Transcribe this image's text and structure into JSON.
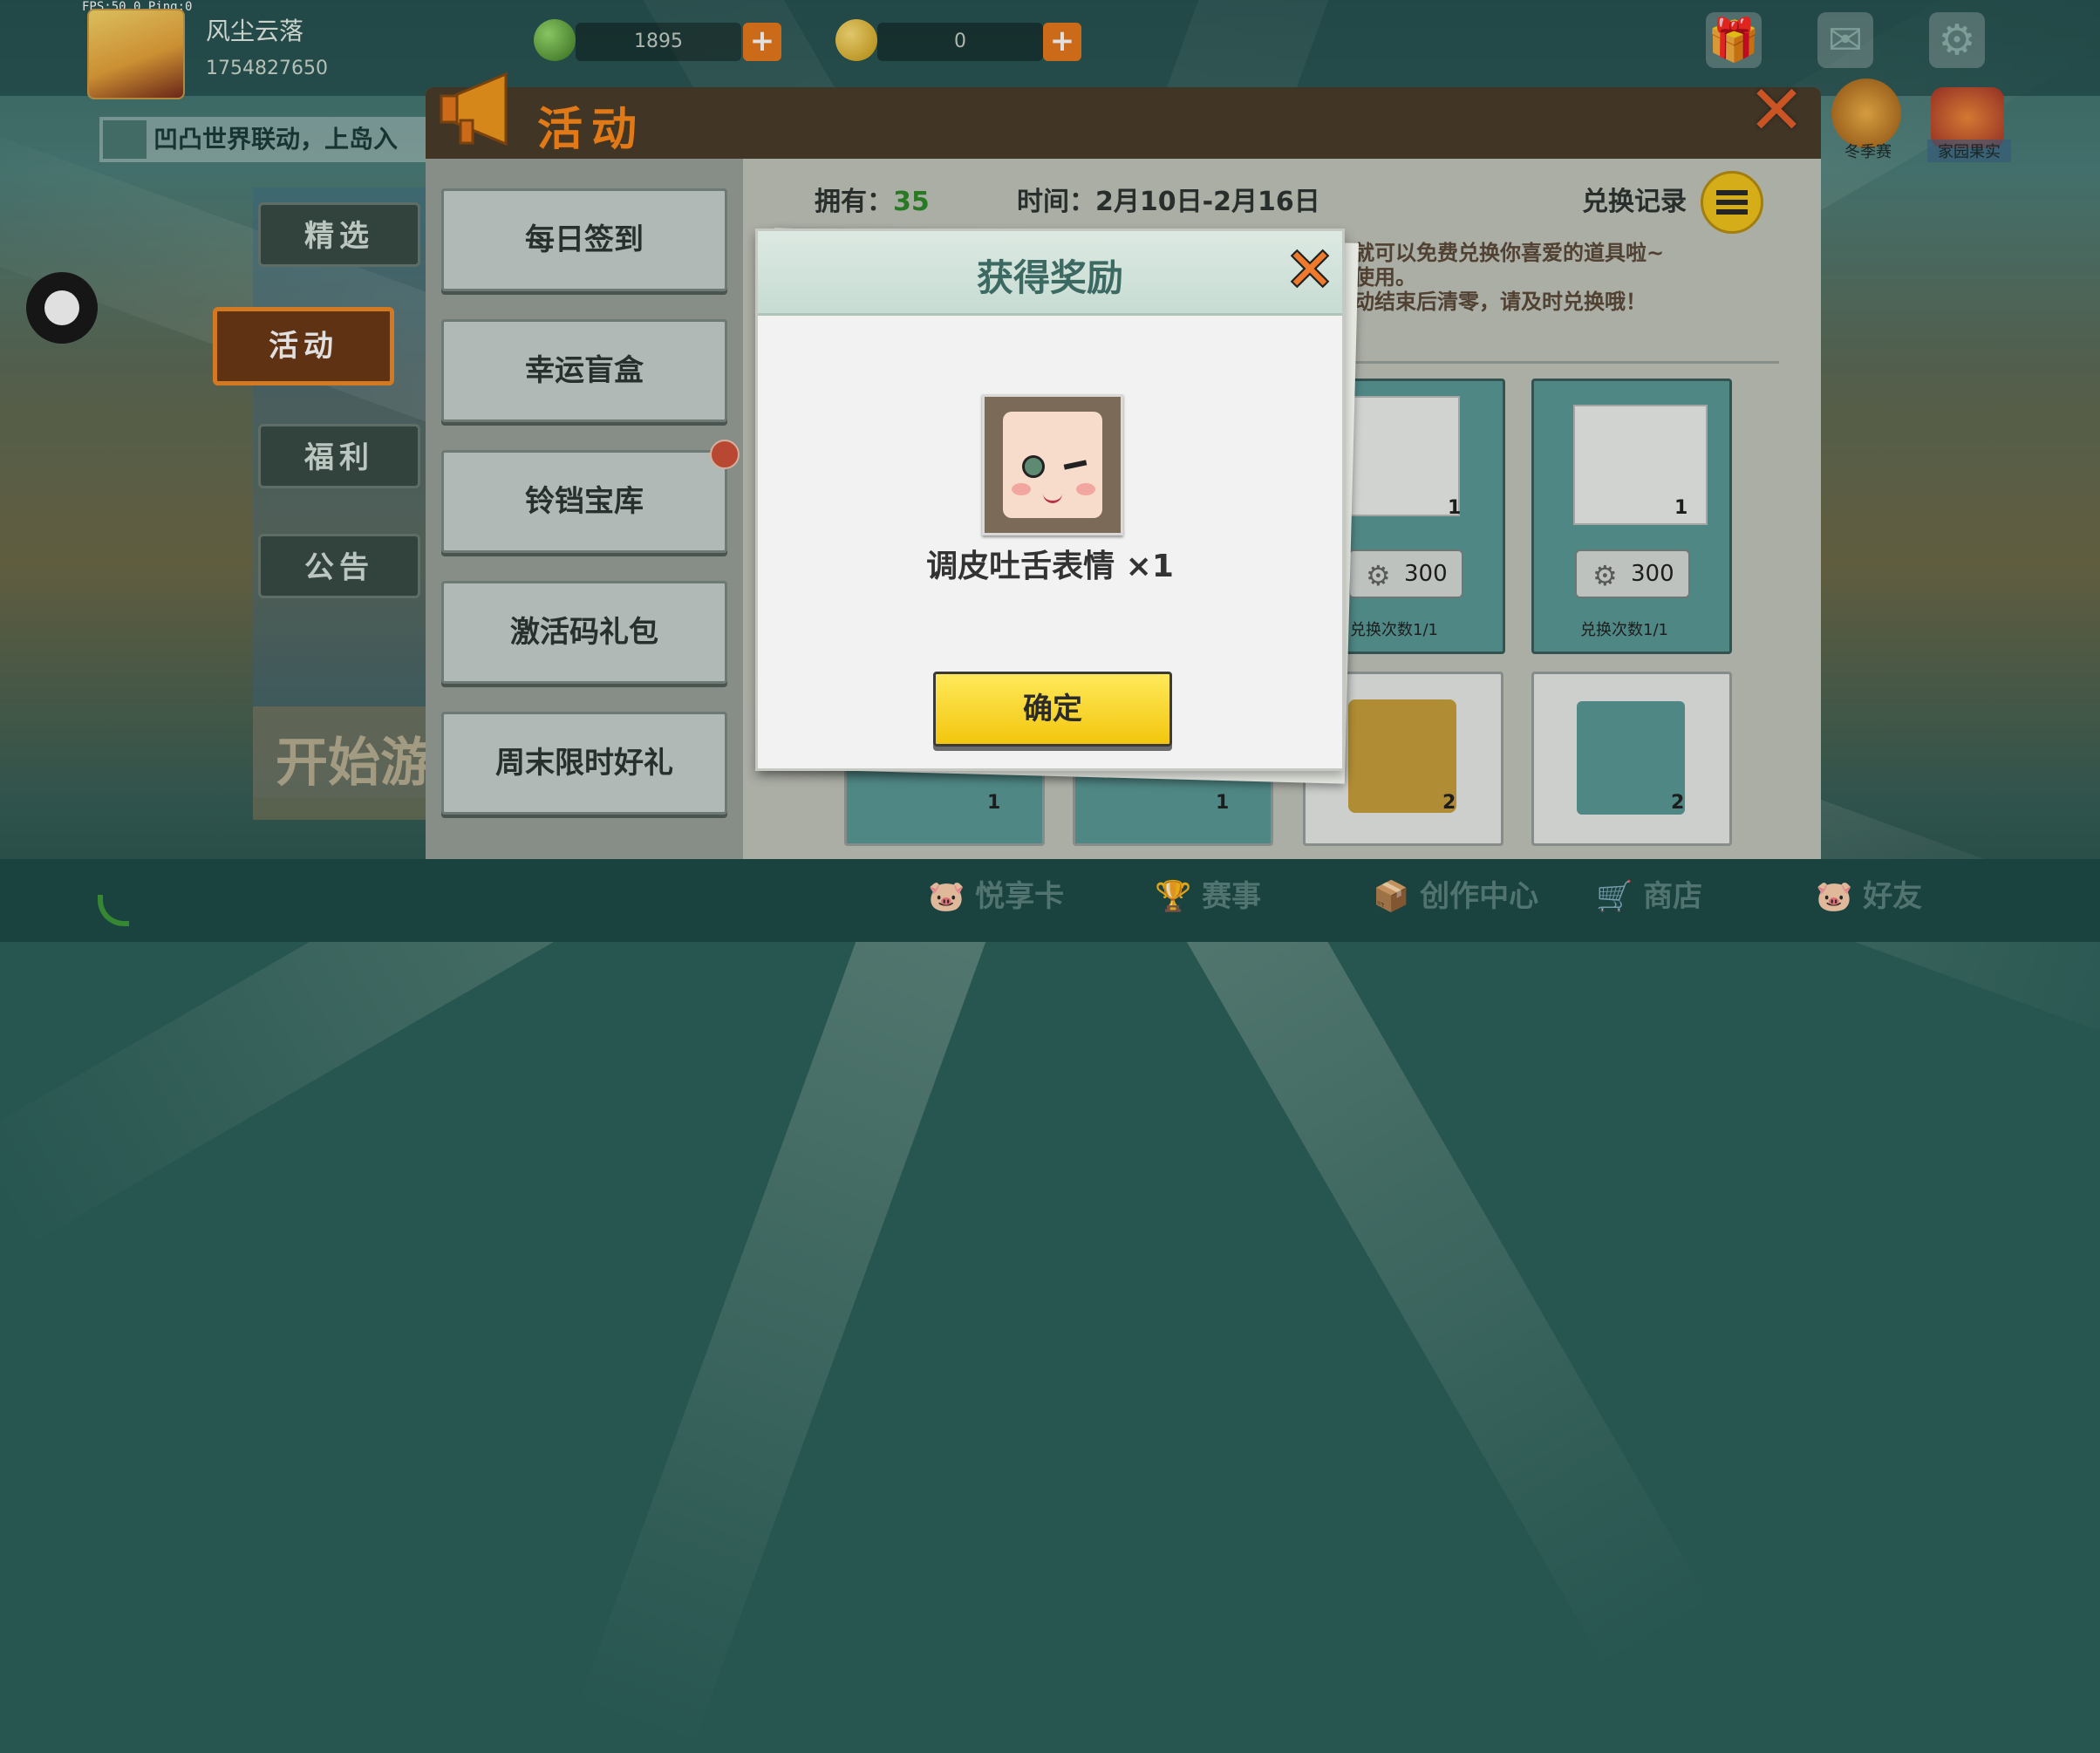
{
  "debug": {
    "fps_ping": "FPS:50.0  Ping:0"
  },
  "profile": {
    "name": "风尘云落",
    "id": "1754827650"
  },
  "resources": {
    "gems": "1895",
    "coins": "0"
  },
  "marquee": "凹凸世界联动，上岛入",
  "left_tabs": [
    "精选",
    "活动",
    "福利",
    "公告"
  ],
  "start_game": "开始游",
  "panel": {
    "title": "活动",
    "menu": [
      "每日签到",
      "幸运盲盒",
      "铃铛宝库",
      "激活码礼包",
      "周末限时好礼"
    ],
    "owned_label": "拥有：",
    "owned_value": "35",
    "time_label": "时间：2月10日-2月16日",
    "history_label": "兑换记录",
    "hint_line1": "就可以免费兑换你喜爱的道具啦~",
    "hint_line2": "使用。",
    "hint_line3": "动结束后清零，请及时兑换哦！"
  },
  "shop_cards": [
    {
      "count": "1",
      "price": "300",
      "redeem": "兑换次数1/1"
    },
    {
      "count": "1",
      "price": "300",
      "redeem": "兑换次数1/1"
    }
  ],
  "shop_cards_row2": [
    {
      "count": "1"
    },
    {
      "count": "1"
    },
    {
      "count": "2"
    },
    {
      "count": "2"
    }
  ],
  "corner_icons": {
    "winter": "冬季赛",
    "garden": "家园果实"
  },
  "bottom_nav": [
    "悦享卡",
    "赛事",
    "创作中心",
    "商店",
    "好友"
  ],
  "modal": {
    "title": "获得奖励",
    "item_name": "调皮吐舌表情 ×1",
    "confirm": "确定"
  }
}
